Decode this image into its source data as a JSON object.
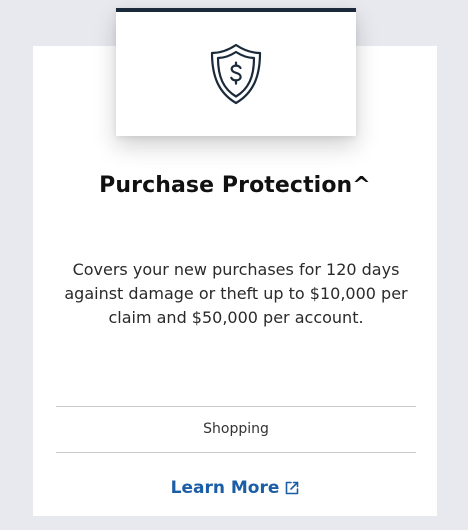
{
  "card": {
    "title": "Purchase Protection^",
    "description": "Covers your new purchases for 120 days against damage or theft up to $10,000 per claim and $50,000 per account.",
    "category": "Shopping",
    "link_label": "Learn More",
    "icon": "shield-dollar-icon",
    "link_icon": "external-link-icon"
  },
  "colors": {
    "page_background": "#e8e9ee",
    "card_background": "#ffffff",
    "icon_box_accent": "#1b2a3a",
    "link": "#1b5ea6",
    "divider": "#c9cbcf"
  }
}
